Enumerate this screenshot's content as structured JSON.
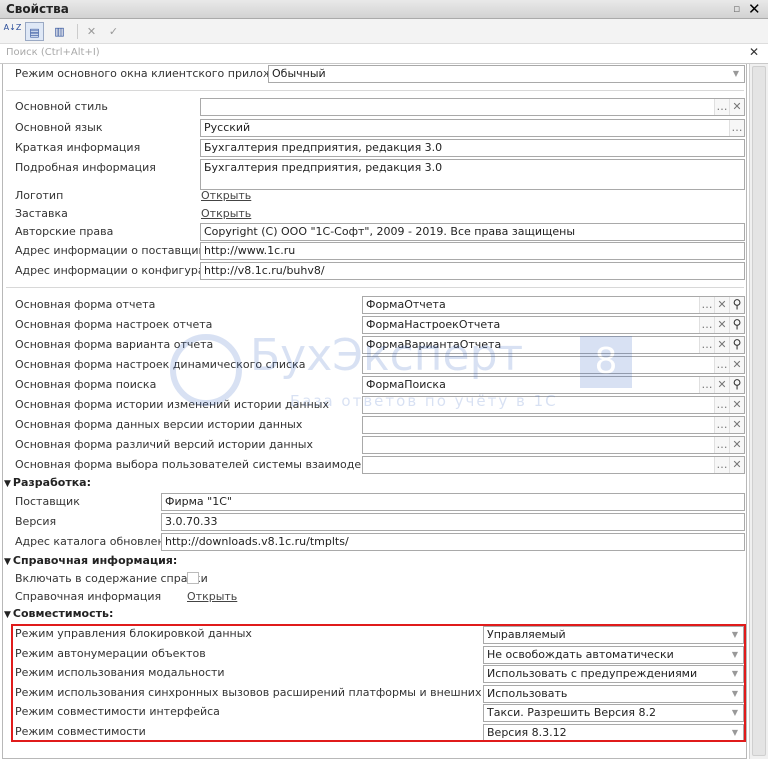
{
  "window": {
    "title": "Свойства",
    "pin": "▫",
    "close": "✕"
  },
  "toolbar": {
    "sort": "A↓Z",
    "cat1": "▤",
    "cat2": "▥",
    "clear": "✕",
    "ok": "✓"
  },
  "search": {
    "placeholder": "Поиск (Ctrl+Alt+I)",
    "clear": "✕"
  },
  "main_mode": {
    "label": "Режим основного окна клиентского приложения",
    "value": "Обычный"
  },
  "general": [
    {
      "label": "Основной стиль",
      "value": ""
    },
    {
      "label": "Основной язык",
      "value": "Русский"
    },
    {
      "label": "Краткая информация",
      "value": "Бухгалтерия предприятия, редакция 3.0"
    },
    {
      "label": "Подробная информация",
      "value": "Бухгалтерия предприятия, редакция 3.0"
    },
    {
      "label": "Логотип",
      "value": "Открыть"
    },
    {
      "label": "Заставка",
      "value": "Открыть"
    },
    {
      "label": "Авторские права",
      "value": "Copyright (C) ООО \"1С-Софт\", 2009 - 2019. Все права защищены"
    },
    {
      "label": "Адрес информации о поставщике",
      "value": "http://www.1c.ru"
    },
    {
      "label": "Адрес информации о конфигурации",
      "value": "http://v8.1c.ru/buhv8/"
    }
  ],
  "forms": [
    {
      "label": "Основная форма отчета",
      "value": "ФормаОтчета"
    },
    {
      "label": "Основная форма настроек отчета",
      "value": "ФормаНастроекОтчета"
    },
    {
      "label": "Основная форма варианта отчета",
      "value": "ФормаВариантаОтчета"
    },
    {
      "label": "Основная форма настроек динамического списка",
      "value": ""
    },
    {
      "label": "Основная форма поиска",
      "value": "ФормаПоиска"
    },
    {
      "label": "Основная форма истории изменений истории данных",
      "value": ""
    },
    {
      "label": "Основная форма данных версии истории данных",
      "value": ""
    },
    {
      "label": "Основная форма различий версий истории данных",
      "value": ""
    },
    {
      "label": "Основная форма выбора пользователей системы взаимодействия",
      "value": ""
    }
  ],
  "development": {
    "title": "Разработка:",
    "rows": [
      {
        "label": "Поставщик",
        "value": "Фирма \"1С\""
      },
      {
        "label": "Версия",
        "value": "3.0.70.33"
      },
      {
        "label": "Адрес каталога обновлений",
        "value": "http://downloads.v8.1c.ru/tmplts/"
      }
    ]
  },
  "help": {
    "title": "Справочная информация:",
    "include_label": "Включать в содержание справки",
    "info_label": "Справочная информация",
    "info_link": "Открыть"
  },
  "compat": {
    "title": "Совместимость:",
    "rows": [
      {
        "label": "Режим управления блокировкой данных",
        "value": "Управляемый"
      },
      {
        "label": "Режим автонумерации объектов",
        "value": "Не освобождать автоматически"
      },
      {
        "label": "Режим использования модальности",
        "value": "Использовать с предупреждениями"
      },
      {
        "label": "Режим использования синхронных вызовов расширений платформы и внешних компонент",
        "value": "Использовать"
      },
      {
        "label": "Режим совместимости интерфейса",
        "value": "Такси. Разрешить Версия 8.2"
      },
      {
        "label": "Режим совместимости",
        "value": "Версия 8.3.12"
      }
    ]
  },
  "watermark": {
    "brand": "БухЭксперт",
    "digit": "8",
    "slogan": "База ответов по учёту в 1С"
  },
  "colors": {
    "highlight": "#e01b1b",
    "accent": "#3060c0"
  }
}
